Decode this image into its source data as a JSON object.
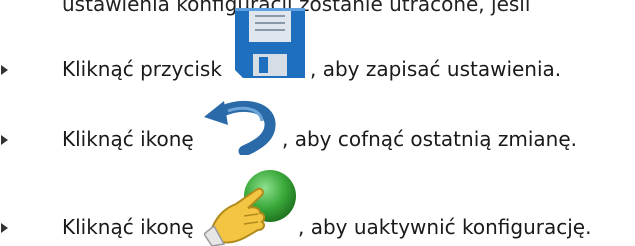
{
  "cut_text": "ustawienia konfiguracji zostanie utracone, jeśli",
  "steps": [
    {
      "before": "Kliknąć przycisk",
      "icon": "save-icon",
      "after": ", aby zapisać ustawienia."
    },
    {
      "before": "Kliknąć ikonę",
      "icon": "undo-icon",
      "after": ", aby cofnąć ostatnią zmianę."
    },
    {
      "before": "Kliknąć ikonę",
      "icon": "activate-icon",
      "after": ", aby uaktywnić konfigurację."
    }
  ],
  "colors": {
    "save_icon_blue": "#1f6fbf",
    "undo_icon_blue": "#2a6aa8",
    "activate_icon_green": "#3aa93a",
    "hand_yellow": "#f4c542"
  }
}
